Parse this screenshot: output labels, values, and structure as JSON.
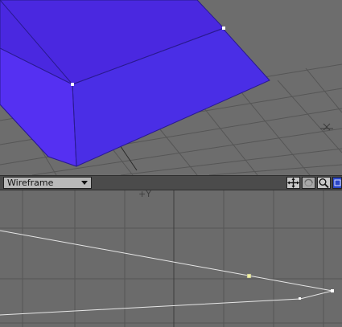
{
  "perspective_view": {
    "axis_label": "X"
  },
  "viewport_bar": {
    "view_mode": "Wireframe",
    "tools": [
      {
        "icon": "move-icon",
        "label": ""
      },
      {
        "icon": "rotate-icon",
        "label": ""
      },
      {
        "icon": "zoom-icon",
        "label": ""
      },
      {
        "icon": "maximize-icon",
        "label": ""
      }
    ]
  },
  "top_view": {
    "axis_label": "+Y"
  },
  "colors": {
    "mesh_fill": "#4a2ee6",
    "viewport_bg": "#6b6b6b",
    "grid_line": "#505050",
    "wire_line": "#e6e6e6"
  }
}
